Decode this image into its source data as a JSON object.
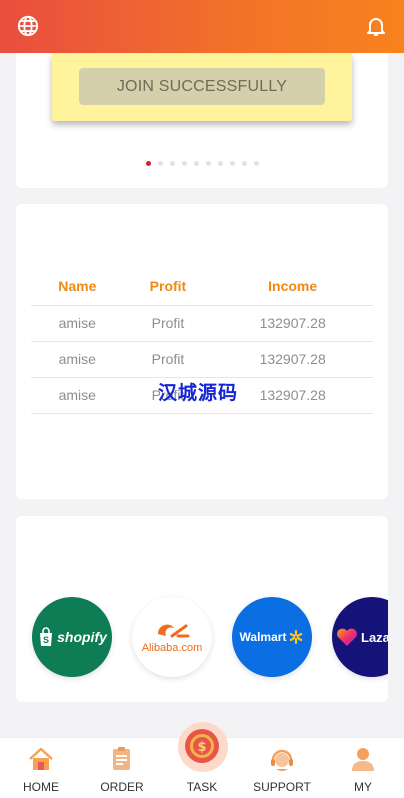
{
  "header": {
    "left_icon": "globe-icon",
    "right_icon": "bell-icon"
  },
  "banner": {
    "join_label": "JOIN SUCCESSFULLY",
    "dots_total": 10,
    "dots_active": 0
  },
  "table": {
    "headers": [
      "Name",
      "Profit",
      "Income"
    ],
    "rows": [
      [
        "amise",
        "Profit",
        "132907.28"
      ],
      [
        "amise",
        "Profit",
        "132907.28"
      ],
      [
        "amise",
        "Profit",
        "132907.28"
      ]
    ]
  },
  "watermark": "汉城源码",
  "partners": [
    "shopify",
    "Alibaba.com",
    "Walmart",
    "Lazada"
  ],
  "tabs": [
    {
      "label": "HOME",
      "icon": "home-icon"
    },
    {
      "label": "ORDER",
      "icon": "clipboard-icon"
    },
    {
      "label": "TASK",
      "icon": "task-coin-icon"
    },
    {
      "label": "SUPPORT",
      "icon": "headset-icon"
    },
    {
      "label": "MY",
      "icon": "user-icon"
    }
  ],
  "colors": {
    "accent": "#f08a16",
    "header_start": "#e94e3f",
    "header_end": "#f9821d"
  }
}
